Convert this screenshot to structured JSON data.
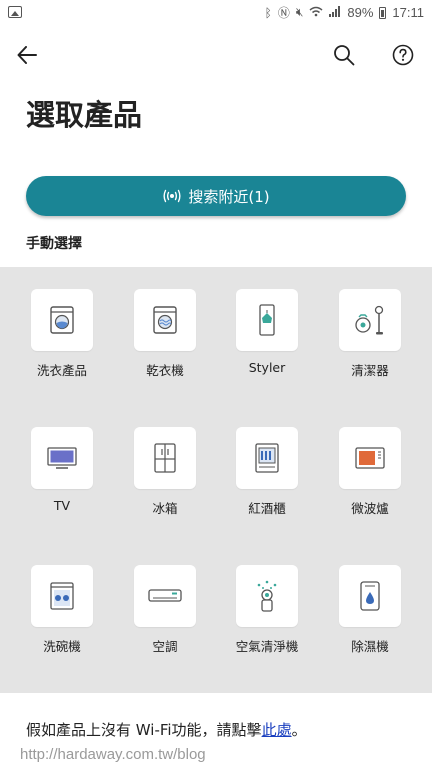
{
  "status_bar": {
    "battery_percent": "89%",
    "time": "17:11",
    "icons": [
      "gallery-icon",
      "bluetooth-icon",
      "nfc-icon",
      "mute-icon",
      "wifi-icon",
      "signal-icon",
      "battery-icon"
    ]
  },
  "header": {
    "icons": [
      "back-arrow-icon",
      "search-icon",
      "help-icon"
    ]
  },
  "page": {
    "title": "選取產品",
    "nearby_button_label": "搜索附近(1)",
    "manual_label": "手動選擇"
  },
  "products": [
    {
      "label": "洗衣產品",
      "icon": "washer-icon"
    },
    {
      "label": "乾衣機",
      "icon": "dryer-icon"
    },
    {
      "label": "Styler",
      "icon": "styler-icon"
    },
    {
      "label": "清潔器",
      "icon": "vacuum-icon"
    },
    {
      "label": "TV",
      "icon": "tv-icon"
    },
    {
      "label": "冰箱",
      "icon": "fridge-icon"
    },
    {
      "label": "紅酒櫃",
      "icon": "wine-cellar-icon"
    },
    {
      "label": "微波爐",
      "icon": "microwave-icon"
    },
    {
      "label": "洗碗機",
      "icon": "dishwasher-icon"
    },
    {
      "label": "空調",
      "icon": "air-conditioner-icon"
    },
    {
      "label": "空氣清淨機",
      "icon": "air-purifier-icon"
    },
    {
      "label": "除濕機",
      "icon": "dehumidifier-icon"
    }
  ],
  "footer": {
    "text": "假如產品上沒有 Wi-Fi功能，請點擊",
    "link": "此處",
    "end": "。"
  },
  "watermark": "http://hardaway.com.tw/blog",
  "colors": {
    "accent": "#1a8595",
    "grid_background": "#e4e4e4",
    "link": "#1a3fbf"
  }
}
